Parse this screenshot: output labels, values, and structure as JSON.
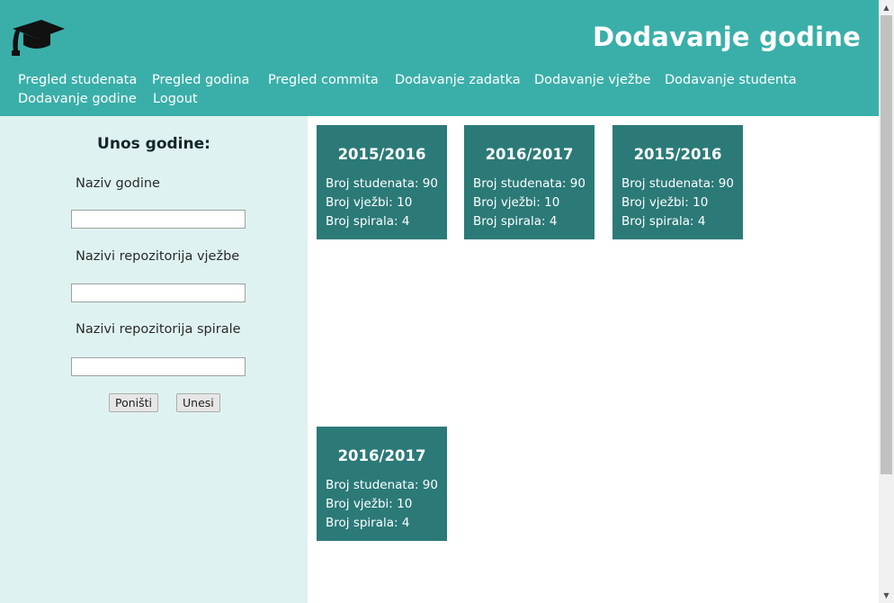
{
  "header": {
    "title": "Dodavanje godine",
    "logo_icon": "graduation-cap-icon",
    "bg_color": "#3aafa9"
  },
  "nav": {
    "items": [
      {
        "label": "Pregled studenata"
      },
      {
        "label": "Pregled godina"
      },
      {
        "label": "Pregled commita"
      },
      {
        "label": "Dodavanje zadatka"
      },
      {
        "label": "Dodavanje vježbe"
      },
      {
        "label": "Dodavanje studenta"
      },
      {
        "label": "Dodavanje godine"
      },
      {
        "label": "Logout"
      }
    ]
  },
  "form": {
    "title": "Unos godine:",
    "fields": [
      {
        "label": "Naziv godine",
        "value": "",
        "placeholder": ""
      },
      {
        "label": "Nazivi repozitorija vježbe",
        "value": "",
        "placeholder": ""
      },
      {
        "label": "Nazivi repozitorija spirale",
        "value": "",
        "placeholder": ""
      }
    ],
    "reset_label": "Poništi",
    "submit_label": "Unesi"
  },
  "cards": [
    {
      "title": "2015/2016",
      "students": "Broj studenata: 90",
      "exercises": "Broj vježbi: 10",
      "spirals": "Broj spirala: 4"
    },
    {
      "title": "2016/2017",
      "students": "Broj studenata: 90",
      "exercises": "Broj vježbi: 10",
      "spirals": "Broj spirala: 4"
    },
    {
      "title": "2015/2016",
      "students": "Broj studenata: 90",
      "exercises": "Broj vježbi: 10",
      "spirals": "Broj spirala: 4"
    },
    {
      "title": "2016/2017",
      "students": "Broj studenata: 90",
      "exercises": "Broj vježbi: 10",
      "spirals": "Broj spirala: 4"
    }
  ],
  "colors": {
    "header": "#3aafa9",
    "sidebar": "#def2f1",
    "card": "#2b7a78"
  }
}
